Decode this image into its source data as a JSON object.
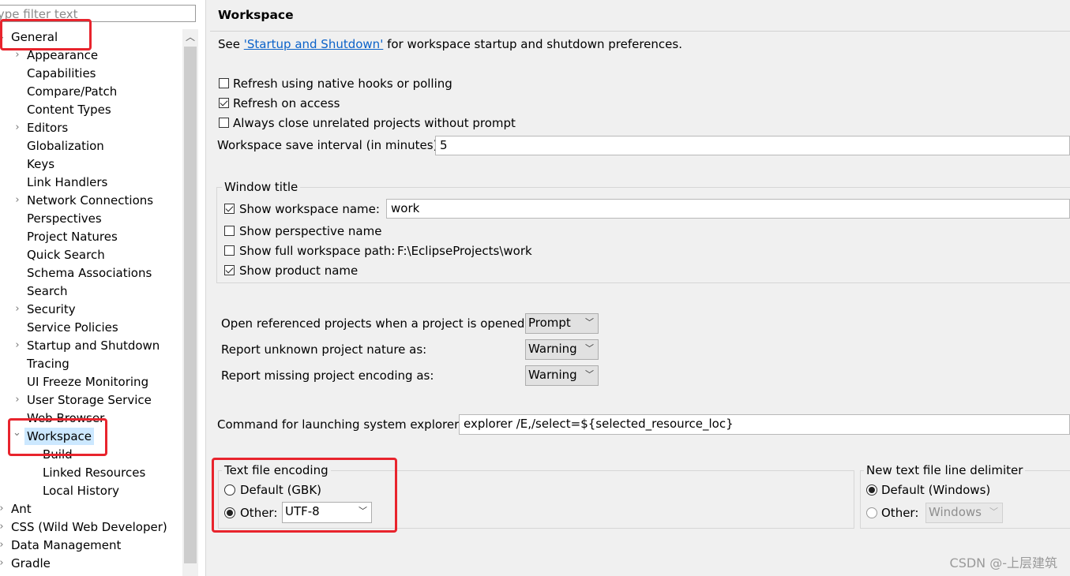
{
  "filter": {
    "placeholder": "type filter text"
  },
  "tree": {
    "general": "General",
    "appearance": "Appearance",
    "capabilities": "Capabilities",
    "compare_patch": "Compare/Patch",
    "content_types": "Content Types",
    "editors": "Editors",
    "globalization": "Globalization",
    "keys": "Keys",
    "link_handlers": "Link Handlers",
    "network_connections": "Network Connections",
    "perspectives": "Perspectives",
    "project_natures": "Project Natures",
    "quick_search": "Quick Search",
    "schema_associations": "Schema Associations",
    "search": "Search",
    "security": "Security",
    "service_policies": "Service Policies",
    "startup_shutdown": "Startup and Shutdown",
    "tracing": "Tracing",
    "ui_freeze": "UI Freeze Monitoring",
    "user_storage": "User Storage Service",
    "web_browser": "Web Browser",
    "workspace": "Workspace",
    "build": "Build",
    "linked_resources": "Linked Resources",
    "local_history": "Local History",
    "ant": "Ant",
    "css": "CSS (Wild Web Developer)",
    "data_management": "Data Management",
    "gradle": "Gradle"
  },
  "page": {
    "title": "Workspace",
    "see_prefix": "See ",
    "see_link": "'Startup and Shutdown'",
    "see_suffix": " for workspace startup and shutdown preferences.",
    "refresh_native": {
      "label": "Refresh using native hooks or polling",
      "checked": false
    },
    "refresh_access": {
      "label": "Refresh on access",
      "checked": true
    },
    "always_close": {
      "label": "Always close unrelated projects without prompt",
      "checked": false
    },
    "save_interval": {
      "label": "Workspace save interval (in minutes):",
      "value": "5"
    },
    "window_title": {
      "group_label": "Window title",
      "show_ws_name": {
        "label": "Show workspace name:",
        "checked": true,
        "value": "work"
      },
      "show_perspective": {
        "label": "Show perspective name",
        "checked": false
      },
      "show_full_path": {
        "label": "Show full workspace path:",
        "checked": false,
        "value": "F:\\EclipseProjects\\work"
      },
      "show_product": {
        "label": "Show product name",
        "checked": true
      }
    },
    "open_referenced": {
      "label": "Open referenced projects when a project is opened:",
      "value": "Prompt"
    },
    "unknown_nature": {
      "label": "Report unknown project nature as:",
      "value": "Warning"
    },
    "missing_encoding": {
      "label": "Report missing project encoding as:",
      "value": "Warning"
    },
    "explorer_cmd": {
      "label": "Command for launching system explorer:",
      "value": "explorer /E,/select=${selected_resource_loc}"
    },
    "encoding": {
      "group_label": "Text file encoding",
      "default_label": "Default (GBK)",
      "other_label": "Other:",
      "other_value": "UTF-8",
      "selected": "other"
    },
    "line_delim": {
      "group_label": "New text file line delimiter",
      "default_label": "Default (Windows)",
      "other_label": "Other:",
      "other_value": "Windows",
      "selected": "default"
    }
  },
  "watermark": "CSDN @-上层建筑",
  "colors": {
    "highlight": "#e8242d",
    "link": "#0b62c9",
    "selection": "#cce8ff"
  }
}
